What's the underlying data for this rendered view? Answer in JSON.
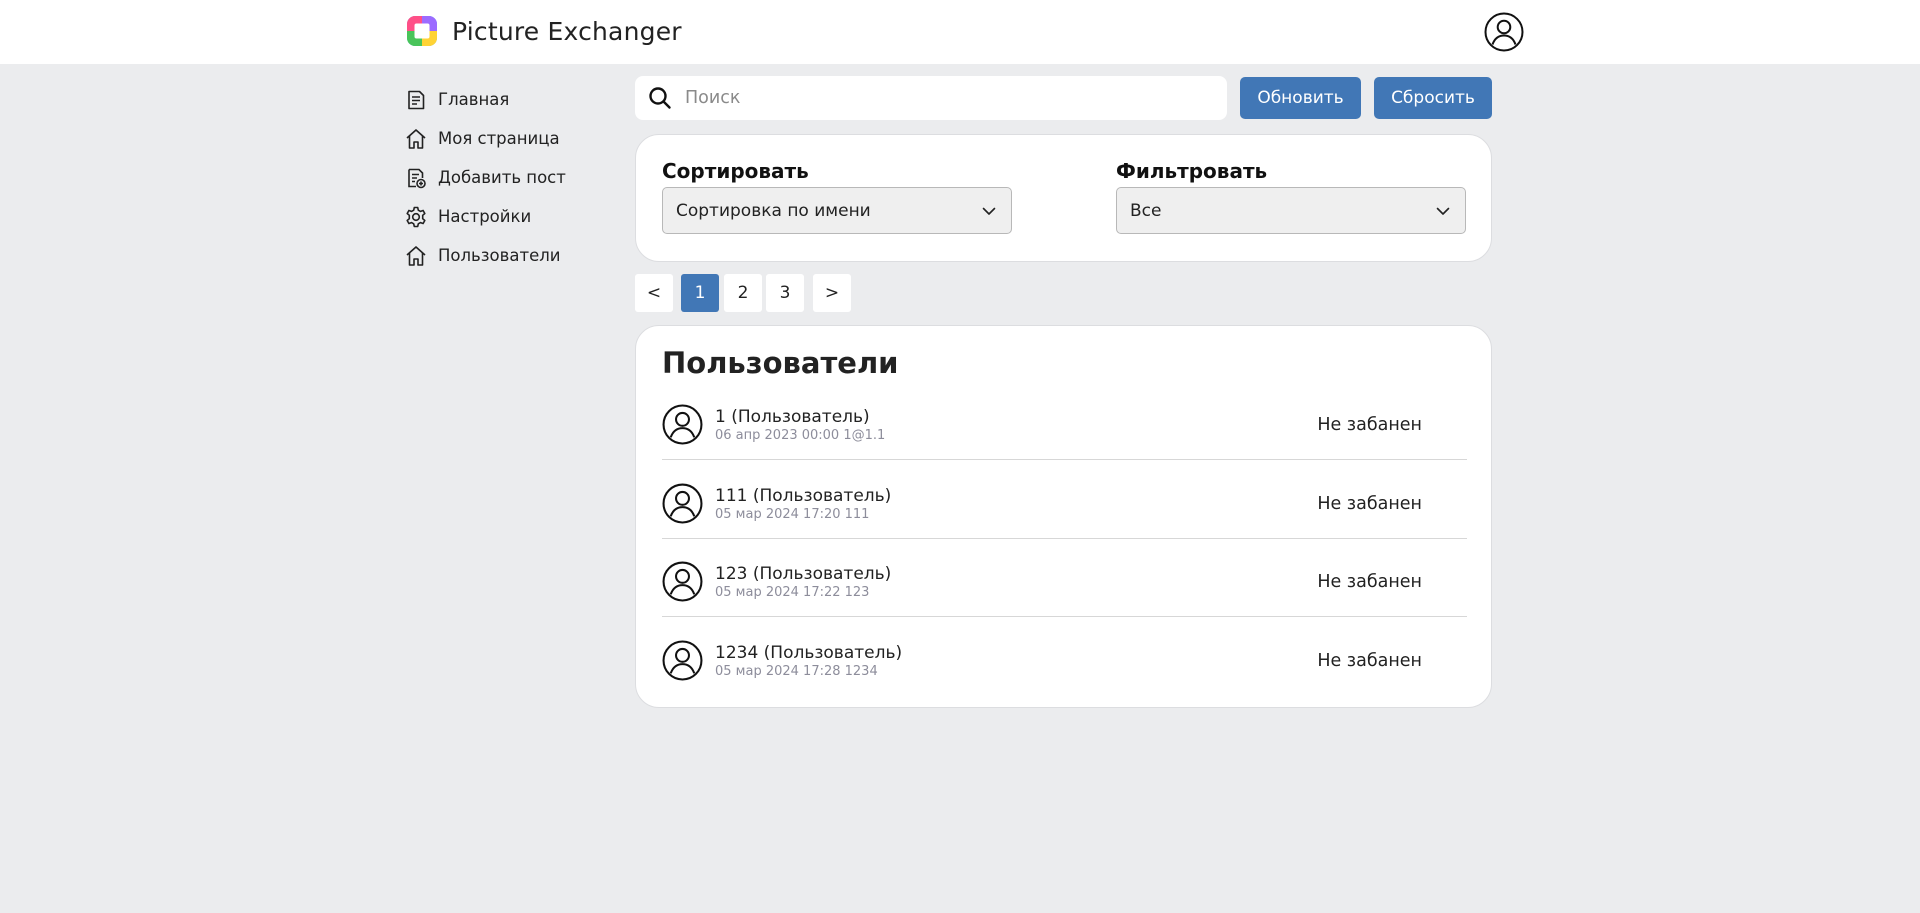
{
  "app": {
    "title": "Picture Exchanger",
    "logo_icon": "app-logo-icon",
    "profile_icon": "user-circle-icon"
  },
  "sidebar": {
    "items": [
      {
        "label": "Главная",
        "icon": "document-icon"
      },
      {
        "label": "Моя страница",
        "icon": "home-icon"
      },
      {
        "label": "Добавить пост",
        "icon": "add-post-icon"
      },
      {
        "label": "Настройки",
        "icon": "gear-icon"
      },
      {
        "label": "Пользователи",
        "icon": "home-icon"
      }
    ]
  },
  "search": {
    "placeholder": "Поиск",
    "value": "",
    "icon": "search-icon"
  },
  "toolbar": {
    "refresh_label": "Обновить",
    "reset_label": "Сбросить"
  },
  "filters": {
    "sort": {
      "title": "Сортировать",
      "selected": "Сортировка по имени"
    },
    "filter": {
      "title": "Фильтровать",
      "selected": "Все"
    }
  },
  "pagination": {
    "prev": "<",
    "pages": [
      "1",
      "2",
      "3"
    ],
    "current": "1",
    "next": ">"
  },
  "users": {
    "title": "Пользователи",
    "rows": [
      {
        "name": "1 (Пользователь)",
        "meta": "06 апр 2023 00:00 1@1.1",
        "status": "Не забанен"
      },
      {
        "name": "111 (Пользователь)",
        "meta": "05 мар 2024 17:20 111",
        "status": "Не забанен"
      },
      {
        "name": "123 (Пользователь)",
        "meta": "05 мар 2024 17:22 123",
        "status": "Не забанен"
      },
      {
        "name": "1234 (Пользователь)",
        "meta": "05 мар 2024 17:28 1234",
        "status": "Не забанен"
      }
    ]
  },
  "colors": {
    "accent": "#4177b6",
    "background": "#ebecee",
    "card": "#ffffff"
  }
}
